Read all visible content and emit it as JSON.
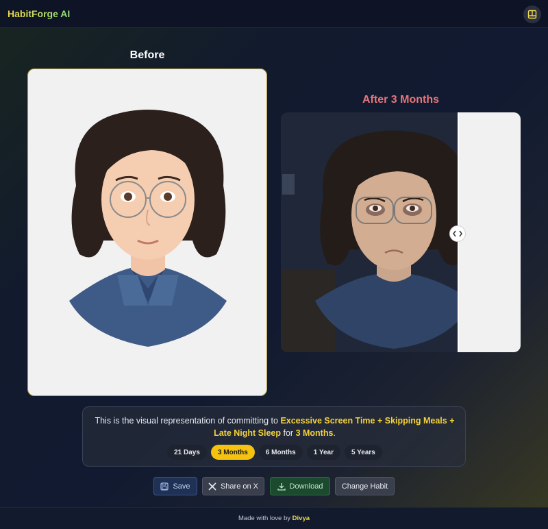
{
  "header": {
    "brand": "HabitForge AI",
    "sidebar_icon": "panel-icon"
  },
  "comparison": {
    "before_title": "Before",
    "after_title": "After 3 Months",
    "slider_icon": "compare-arrows-icon",
    "slider_position": 0.74
  },
  "info": {
    "prefix": "This is the visual representation of committing to ",
    "habits": "Excessive Screen Time + Skipping Meals + Late Night Sleep",
    "middle": " for ",
    "duration": "3 Months",
    "suffix": "."
  },
  "durations": {
    "options": [
      "21 Days",
      "3 Months",
      "6 Months",
      "1 Year",
      "5 Years"
    ],
    "selected": "3 Months"
  },
  "actions": {
    "save": "Save",
    "share": "Share on X",
    "download": "Download",
    "change_habit": "Change Habit"
  },
  "footer": {
    "prefix": "Made with love by ",
    "author": "Divya"
  },
  "colors": {
    "accent_yellow": "#f4c20f",
    "after_title": "#e8767a",
    "brand_gradient_start": "#f3d94a",
    "brand_gradient_end": "#8fe07a"
  }
}
